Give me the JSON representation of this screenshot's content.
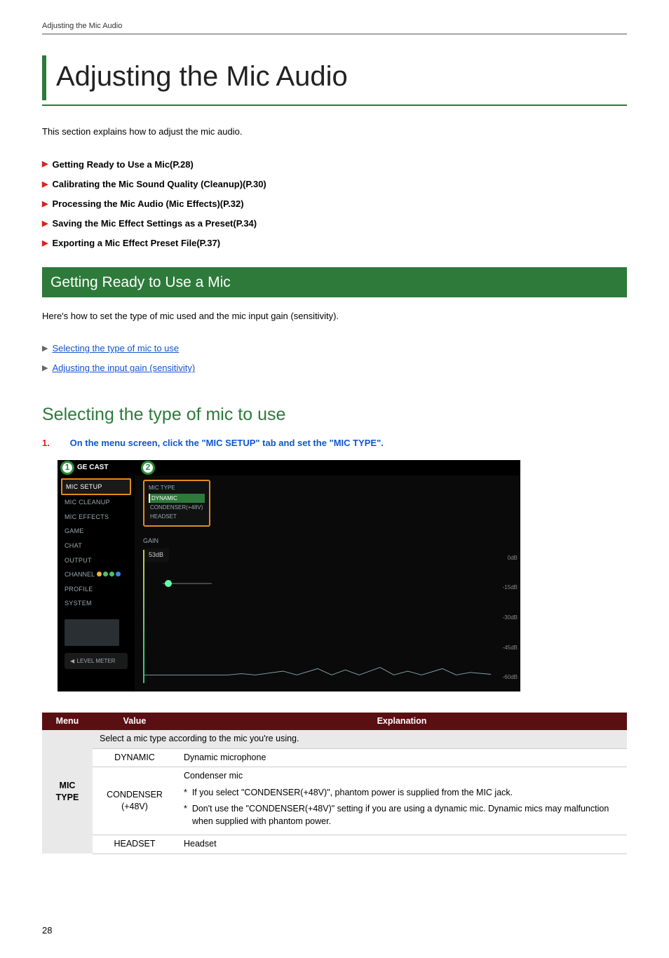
{
  "header": {
    "running_title": "Adjusting the Mic Audio"
  },
  "title": "Adjusting the Mic Audio",
  "intro": "This section explains how to adjust the mic audio.",
  "bullets": [
    "Getting Ready to Use a Mic(P.28)",
    "Calibrating the Mic Sound Quality (Cleanup)(P.30)",
    "Processing the Mic Audio (Mic Effects)(P.32)",
    "Saving the Mic Effect Settings as a Preset(P.34)",
    "Exporting a Mic Effect Preset File(P.37)"
  ],
  "section_bar": "Getting Ready to Use a Mic",
  "section_intro": "Here's how to set the type of mic used and the mic input gain (sensitivity).",
  "links": [
    "Selecting the type of mic to use",
    "Adjusting the input gain (sensitivity)"
  ],
  "subhead": "Selecting the type of mic to use",
  "step_num": "1.",
  "step_text": "On the menu screen, click the \"MIC SETUP\" tab and set the \"MIC TYPE\".",
  "mock": {
    "logo_suffix": "GE CAST",
    "sidebar": {
      "items": [
        "MIC SETUP",
        "MIC CLEANUP",
        "MIC EFFECTS",
        "GAME",
        "CHAT",
        "OUTPUT"
      ],
      "channel_label": "CHANNEL",
      "profile": "PROFILE",
      "system": "SYSTEM",
      "level_meter": "LEVEL\nMETER"
    },
    "main": {
      "mictype_label": "MIC TYPE",
      "options": [
        "DYNAMIC",
        "CONDENSER(+48V)",
        "HEADSET"
      ],
      "gain_label": "GAIN",
      "gain_value": "53dB",
      "scale": [
        "0dB",
        "-15dB",
        "-30dB",
        "-45dB",
        "-60dB"
      ]
    },
    "callouts": {
      "one": "1",
      "two": "2"
    }
  },
  "table": {
    "headers": {
      "menu": "Menu",
      "value": "Value",
      "explanation": "Explanation"
    },
    "select_note": "Select a mic type according to the mic you're using.",
    "menu_label": "MIC TYPE",
    "rows": [
      {
        "value": "DYNAMIC",
        "explanation": "Dynamic microphone"
      },
      {
        "value": "CONDENSER (+48V)",
        "explanation_head": "Condenser mic",
        "note1": "If you select \"CONDENSER(+48V)\", phantom power is supplied from the MIC jack.",
        "note2": "Don't use the \"CONDENSER(+48V)\" setting if you are using a dynamic mic. Dynamic mics may malfunction when supplied with phantom power."
      },
      {
        "value": "HEADSET",
        "explanation": "Headset"
      }
    ]
  },
  "page_number": "28"
}
